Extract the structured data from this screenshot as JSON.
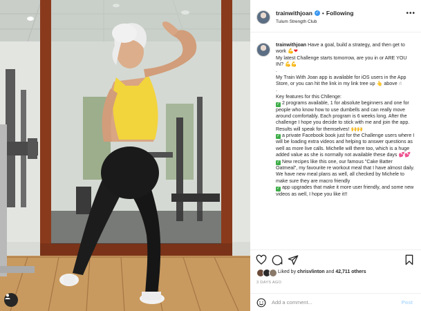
{
  "header": {
    "username": "trainwithjoan",
    "separator": "•",
    "follow_label": "Following",
    "location": "Tulum Strength Club"
  },
  "caption": {
    "username": "trainwithjoan",
    "line1": "Have a goal, build a strategy, and then get to work",
    "line2": "My latest Challenge starts tomorrow, are you in or ARE YOU IN?",
    "dot1": ".",
    "para_app": "My Train With Joan app is available for iOS users in the App Store, or you can hit the link in my link tree up",
    "para_app_end": "above",
    "dot2": ".",
    "features_title": "Key features for this Chllenge:",
    "feature1": "2 programs available, 1 for absolute beginners and one for people who know how to use dumbells and can really move around comfortably. Each program is 6 weeks long. After the challenge I hope you decide to stick with me and join the app. Results will speak for themselves!",
    "feature2": "a private Facebook book just for the Challenge users where I will be loading extra videos and helping to answer questions as well as more live calls. Michelle will there too, which is a huge added value as she is normally not available these days",
    "feature3": "New recipes like this one, our famous \"Cake Batter Oatmeal\", my favourite re workout meal that I have almost daily. We have new meal plans as well, all checked by Michele to make sure they are macro friendly",
    "feature4": "app upgrades that make it more user friendly, and some new videos as well, I hope you like it!!"
  },
  "icons": {
    "like": "heart-icon",
    "comment": "comment-icon",
    "share": "paper-plane-icon",
    "save": "bookmark-icon",
    "emoji": "smiley-icon",
    "tags": "user-tag-icon",
    "verified": "verified-badge-icon",
    "more": "more-options-icon"
  },
  "likes": {
    "prefix": "Liked by",
    "user": "chrisvlinton",
    "conjunction": "and",
    "others": "42,711 others"
  },
  "timestamp": "3 DAYS AGO",
  "comment_box": {
    "placeholder": "Add a comment...",
    "post_label": "Post"
  },
  "colors": {
    "verified_blue": "#3897f0",
    "post_disabled": "#b3dbff",
    "heart_red": "#ed1c24",
    "check_green": "#3fae49",
    "muted_text": "#8e8e8e",
    "shirt_yellow": "#f2d43c"
  }
}
